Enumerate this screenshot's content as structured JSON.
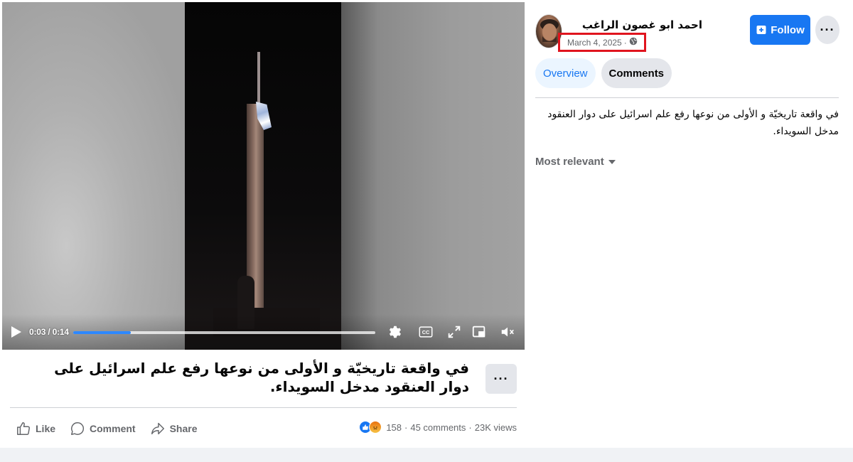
{
  "video": {
    "current_time": "0:03",
    "duration": "0:14",
    "time_label": "0:03 / 0:14",
    "progress_fraction": 0.19
  },
  "post": {
    "caption": "في واقعة تاريخيّة و الأولى من نوعها رفع علم اسرائيل على دوار العنقود مدخل السويداء.",
    "more_label": "···",
    "actions": {
      "like": "Like",
      "comment": "Comment",
      "share": "Share"
    },
    "stats": {
      "reaction_count": "158",
      "comments": "45 comments",
      "views": "23K views",
      "separator": "·"
    }
  },
  "panel": {
    "author": "احمد ابو غصون الراغب",
    "date": "March 4, 2025",
    "date_separator": "·",
    "follow_label": "Follow",
    "more_label": "···",
    "tabs": [
      {
        "label": "Overview",
        "active": true
      },
      {
        "label": "Comments",
        "active": false
      }
    ],
    "post_text": "في واقعة تاريخيّة و الأولى من نوعها رفع علم اسرائيل على دوار العنقود مدخل السويداء.",
    "sort_label": "Most relevant"
  },
  "colors": {
    "brand": "#1877f2",
    "progress": "#2d88ff",
    "highlight_box": "#e0141e",
    "secondary_text": "#65676b"
  },
  "icons": [
    "play-icon",
    "settings-icon",
    "captions-icon",
    "fullscreen-icon",
    "pip-icon",
    "mute-icon",
    "like-icon",
    "comment-icon",
    "share-icon",
    "globe-icon",
    "follow-icon",
    "caret-down-icon"
  ]
}
